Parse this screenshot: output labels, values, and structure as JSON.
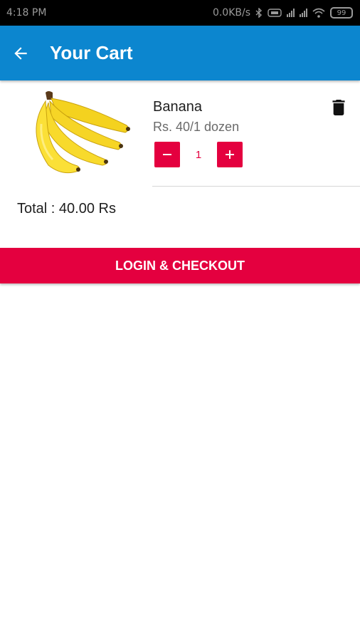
{
  "status_bar": {
    "time": "4:18 PM",
    "network_speed": "0.0KB/s",
    "battery_level": "99",
    "icons": [
      "bluetooth-icon",
      "hd-icon",
      "signal-icon",
      "signal-icon",
      "wifi-icon",
      "battery-icon"
    ]
  },
  "app_bar": {
    "title": "Your Cart",
    "back_icon": "back-arrow-icon",
    "background_color": "#0c86cf"
  },
  "cart": {
    "items": [
      {
        "name": "Banana",
        "price": "Rs. 40/1 dozen",
        "quantity": "1",
        "image": "banana-bunch",
        "delete_icon": "trash-icon",
        "minus_icon": "minus-icon",
        "plus_icon": "plus-icon"
      }
    ],
    "total": "Total : 40.00 Rs"
  },
  "checkout": {
    "label": "LOGIN & CHECKOUT",
    "color": "#e4003f"
  }
}
